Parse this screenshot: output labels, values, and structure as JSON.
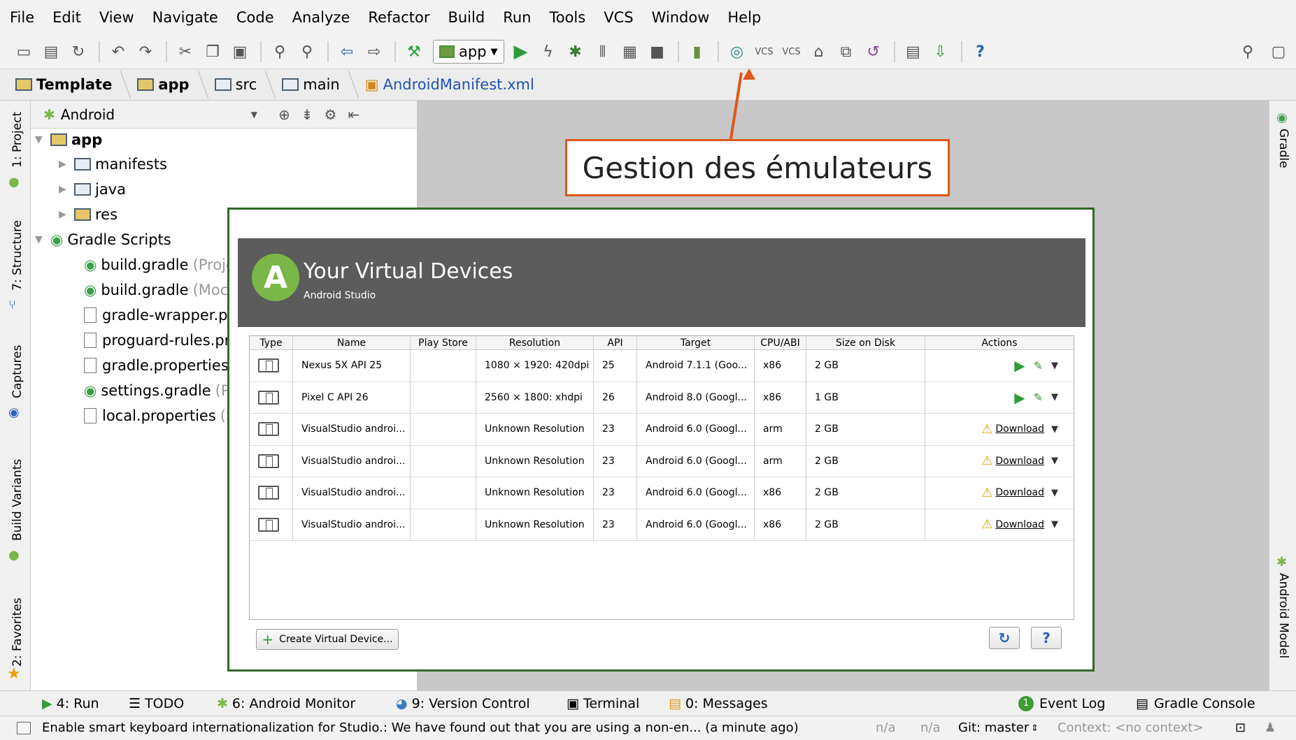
{
  "menu": [
    "File",
    "Edit",
    "View",
    "Navigate",
    "Code",
    "Analyze",
    "Refactor",
    "Build",
    "Run",
    "Tools",
    "VCS",
    "Window",
    "Help"
  ],
  "toolbar": {
    "run_config": "app",
    "icons": [
      "open-icon",
      "save-icon",
      "sync-icon",
      "undo-icon",
      "redo-icon",
      "cut-icon",
      "copy-icon",
      "paste-icon",
      "find-icon",
      "replace-icon",
      "back-icon",
      "forward-icon",
      "make-icon",
      "run-icon",
      "apply-changes-icon",
      "debug-icon",
      "profile-icon",
      "attach-debugger-icon",
      "stop-icon",
      "avd-manager-icon",
      "sync-gradle-icon",
      "vcs-update-icon",
      "vcs-commit-icon",
      "sdk-manager-icon",
      "device-monitor-icon",
      "revert-icon",
      "project-structure-icon",
      "android-device-icon",
      "help-icon"
    ]
  },
  "breadcrumb": [
    "Template",
    "app",
    "src",
    "main",
    "AndroidManifest.xml"
  ],
  "project": {
    "view": "Android",
    "tree": {
      "app": "app",
      "manifests": "manifests",
      "java": "java",
      "res": "res",
      "gradle_scripts": "Gradle Scripts",
      "build_gradle_1": "build.gradle",
      "build_gradle_1_hint": "(Proje",
      "build_gradle_2": "build.gradle",
      "build_gradle_2_hint": "(Moc",
      "gradle_wrapper": "gradle-wrapper.pr",
      "proguard": "proguard-rules.pr",
      "gradle_props": "gradle.properties",
      "settings_gradle": "settings.gradle",
      "settings_gradle_hint": "(Pr",
      "local_props": "local.properties",
      "local_props_hint": "(S"
    }
  },
  "left_tabs": [
    "1: Project",
    "7: Structure",
    "Captures",
    "Build Variants",
    "2: Favorites"
  ],
  "right_tabs": [
    "Gradle",
    "Android Model"
  ],
  "callout": "Gestion des émulateurs",
  "avd": {
    "title": "Your Virtual Devices",
    "subtitle": "Android Studio",
    "columns": [
      "Type",
      "Name",
      "Play Store",
      "Resolution",
      "API",
      "Target",
      "CPU/ABI",
      "Size on Disk",
      "Actions"
    ],
    "rows": [
      {
        "name": "Nexus 5X API 25",
        "play_store": "",
        "resolution": "1080 × 1920: 420dpi",
        "api": "25",
        "target": "Android 7.1.1 (Goo...",
        "cpu": "x86",
        "size": "2 GB",
        "action": "run"
      },
      {
        "name": "Pixel C API 26",
        "play_store": "",
        "resolution": "2560 × 1800: xhdpi",
        "api": "26",
        "target": "Android 8.0 (Googl...",
        "cpu": "x86",
        "size": "1 GB",
        "action": "run"
      },
      {
        "name": "VisualStudio androi...",
        "play_store": "",
        "resolution": "Unknown Resolution",
        "api": "23",
        "target": "Android 6.0 (Googl...",
        "cpu": "arm",
        "size": "2 GB",
        "action": "Download"
      },
      {
        "name": "VisualStudio androi...",
        "play_store": "",
        "resolution": "Unknown Resolution",
        "api": "23",
        "target": "Android 6.0 (Googl...",
        "cpu": "arm",
        "size": "2 GB",
        "action": "Download"
      },
      {
        "name": "VisualStudio androi...",
        "play_store": "",
        "resolution": "Unknown Resolution",
        "api": "23",
        "target": "Android 6.0 (Googl...",
        "cpu": "x86",
        "size": "2 GB",
        "action": "Download"
      },
      {
        "name": "VisualStudio androi...",
        "play_store": "",
        "resolution": "Unknown Resolution",
        "api": "23",
        "target": "Android 6.0 (Googl...",
        "cpu": "x86",
        "size": "2 GB",
        "action": "Download"
      }
    ],
    "create_button": "Create Virtual Device...",
    "refresh_icon": "↻",
    "help_label": "?"
  },
  "bottom_tools": {
    "run": "4: Run",
    "todo": "TODO",
    "android_monitor": "6: Android Monitor",
    "version_control": "9: Version Control",
    "terminal": "Terminal",
    "messages": "0: Messages",
    "event_log_count": "1",
    "event_log": "Event Log",
    "gradle_console": "Gradle Console"
  },
  "status": {
    "message": "Enable smart keyboard internationalization for Studio.: We have found out that you are using a non-en... (a minute ago)",
    "na1": "n/a",
    "na2": "n/a",
    "git": "Git: master",
    "context": "Context: <no context>"
  },
  "colors": {
    "callout_border": "#e0561c",
    "dialog_border": "#37652f",
    "run_green": "#2f9e3a",
    "android_green": "#7ab648"
  }
}
